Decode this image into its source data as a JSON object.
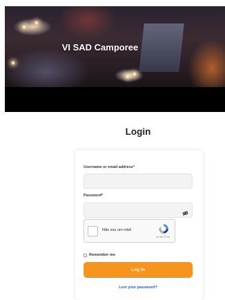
{
  "hero": {
    "title": "VI SAD Camporee"
  },
  "login": {
    "heading": "Login",
    "username_label": "Username or email address*",
    "username_value": "",
    "password_label": "Password*",
    "password_value": "",
    "recaptcha": {
      "label": "Não sou um robô",
      "brand": "reCAPTCHA"
    },
    "remember_label": "Remember me",
    "submit_label": "Log in",
    "lost_password_label": "Lost your password?"
  },
  "colors": {
    "accent": "#f7941d",
    "link": "#2a5db0",
    "banner_bg": "#000000"
  }
}
